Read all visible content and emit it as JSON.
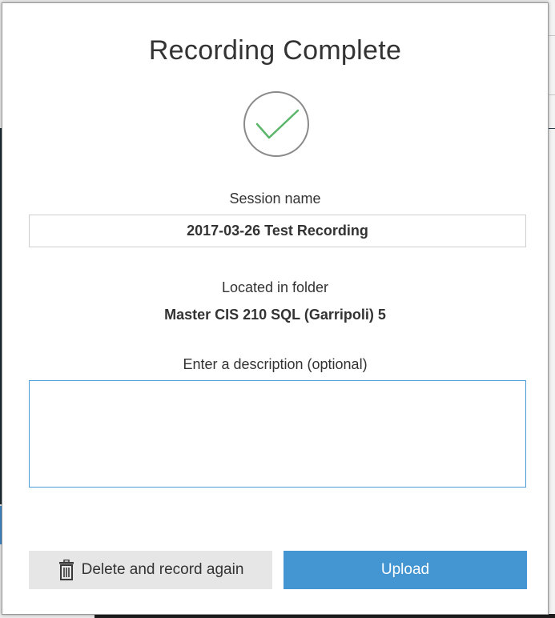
{
  "dialog": {
    "title": "Recording Complete",
    "success_icon": "checkmark-circle-icon",
    "session_name_label": "Session name",
    "session_name_value": "2017-03-26 Test Recording",
    "folder_label": "Located in folder",
    "folder_name": "Master CIS 210 SQL (Garripoli) 5",
    "description_label": "Enter a description (optional)",
    "description_value": "",
    "delete_button_label": "Delete and record again",
    "delete_button_icon": "trash-icon",
    "upload_button_label": "Upload"
  },
  "colors": {
    "check": "#5bb56a",
    "upload_button": "#4396d2",
    "delete_button": "#e6e6e6",
    "textarea_border": "#4b9bd6"
  }
}
